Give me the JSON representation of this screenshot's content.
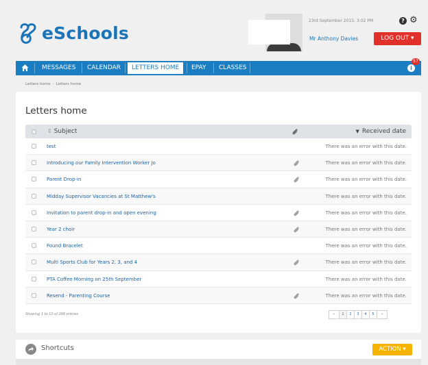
{
  "header": {
    "logo_text": "eSchools",
    "date_line": "23rd September 2015, 3:02 PM",
    "user_name": "Mr Anthony Davies",
    "logout_label": "LOG OUT ▾",
    "help_label": "?",
    "settings_label": "⚙"
  },
  "nav": {
    "items": [
      "MESSAGES",
      "CALENDAR",
      "LETTERS HOME",
      "EPAY",
      "CLASSES"
    ],
    "active": "LETTERS HOME",
    "notification_count": "57",
    "info_label": "i"
  },
  "breadcrumb": {
    "items": [
      "Letters home",
      "Letters home"
    ],
    "separator": "›"
  },
  "page": {
    "title": "Letters home"
  },
  "table": {
    "headers": {
      "subject": "Subject",
      "received": "Received date",
      "subject_sort_icon": "⇕",
      "received_sort_icon": "▼"
    },
    "rows": [
      {
        "subject": "test",
        "attachment": false,
        "received": "There was an error with this date."
      },
      {
        "subject": "Introducing our Family Intervention Worker Jo",
        "attachment": true,
        "received": "There was an error with this date."
      },
      {
        "subject": "Parent Drop-in",
        "attachment": true,
        "received": "There was an error with this date."
      },
      {
        "subject": "Midday Supervisor Vacancies at St Matthew's",
        "attachment": false,
        "received": "There was an error with this date."
      },
      {
        "subject": "Invitation to parent drop-in and open evening",
        "attachment": true,
        "received": "There was an error with this date."
      },
      {
        "subject": "Year 2 choir",
        "attachment": true,
        "received": "There was an error with this date."
      },
      {
        "subject": "Found Bracelet",
        "attachment": false,
        "received": "There was an error with this date."
      },
      {
        "subject": "Multi Sports Club for Years 2, 3, and 4",
        "attachment": true,
        "received": "There was an error with this date."
      },
      {
        "subject": "PTA Coffee Morning on 25th September",
        "attachment": false,
        "received": "There was an error with this date."
      },
      {
        "subject": "Resend - Parenting Course",
        "attachment": true,
        "received": "There was an error with this date."
      }
    ],
    "info": "Showing 1 to 10 of 266 entries"
  },
  "pagination": {
    "prev": "«",
    "pages": [
      "1",
      "2",
      "3",
      "4",
      "5"
    ],
    "current": "1",
    "next": "»"
  },
  "shortcuts": {
    "title": "Shortcuts",
    "action_label": "ACTION ▾"
  },
  "colors": {
    "brand_blue": "#1b7ec2",
    "link_blue": "#1b62a8",
    "logout_red": "#e2302b",
    "action_yellow": "#f6b400"
  },
  "icons": {
    "logo": "eschools-logo-icon",
    "home": "home-icon",
    "help": "help-icon",
    "settings": "gear-icon",
    "info": "info-icon",
    "attachment": "paperclip-icon",
    "shortcuts": "share-arrow-icon"
  }
}
